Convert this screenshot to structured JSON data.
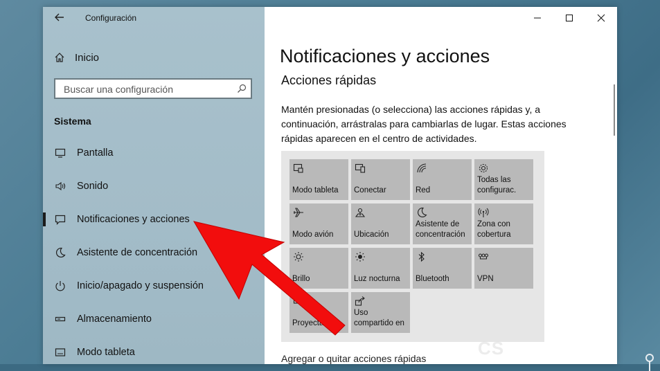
{
  "window": {
    "title": "Configuración"
  },
  "sidebar": {
    "home_label": "Inicio",
    "search_placeholder": "Buscar una configuración",
    "section_title": "Sistema",
    "items": [
      {
        "label": "Pantalla",
        "icon": "monitor-icon"
      },
      {
        "label": "Sonido",
        "icon": "speaker-icon"
      },
      {
        "label": "Notificaciones y acciones",
        "icon": "notification-icon",
        "active": true
      },
      {
        "label": "Asistente de concentración",
        "icon": "moon-icon"
      },
      {
        "label": "Inicio/apagado y suspensión",
        "icon": "power-icon"
      },
      {
        "label": "Almacenamiento",
        "icon": "storage-icon"
      },
      {
        "label": "Modo tableta",
        "icon": "tablet-mode-icon"
      }
    ]
  },
  "main": {
    "title": "Notificaciones y acciones",
    "subhead": "Acciones rápidas",
    "description": "Mantén presionadas (o selecciona) las acciones rápidas y, a continuación, arrástralas para cambiarlas de lugar. Estas acciones rápidas aparecen en el centro de actividades.",
    "tiles": [
      {
        "label": "Modo tableta",
        "icon": "tablet-mode-icon"
      },
      {
        "label": "Conectar",
        "icon": "connect-icon"
      },
      {
        "label": "Red",
        "icon": "network-icon"
      },
      {
        "label": "Todas las configurac.",
        "icon": "gear-icon"
      },
      {
        "label": "Modo avión",
        "icon": "airplane-icon"
      },
      {
        "label": "Ubicación",
        "icon": "location-icon"
      },
      {
        "label": "Asistente de concentración",
        "icon": "moon-icon"
      },
      {
        "label": "Zona con cobertura",
        "icon": "hotspot-icon"
      },
      {
        "label": "Brillo",
        "icon": "brightness-icon"
      },
      {
        "label": "Luz nocturna",
        "icon": "night-light-icon"
      },
      {
        "label": "Bluetooth",
        "icon": "bluetooth-icon"
      },
      {
        "label": "VPN",
        "icon": "vpn-icon"
      },
      {
        "label": "Proyectar",
        "icon": "project-icon"
      },
      {
        "label": "Uso compartido en",
        "icon": "share-icon"
      }
    ],
    "bottom_link": "Agregar o quitar acciones rápidas"
  },
  "watermark": "CS",
  "colors": {
    "sidebar_bg": "#a8c1cc",
    "tile_bg": "#b9b9b9",
    "tiles_area_bg": "#e6e6e6",
    "arrow": "#f20d0d"
  }
}
